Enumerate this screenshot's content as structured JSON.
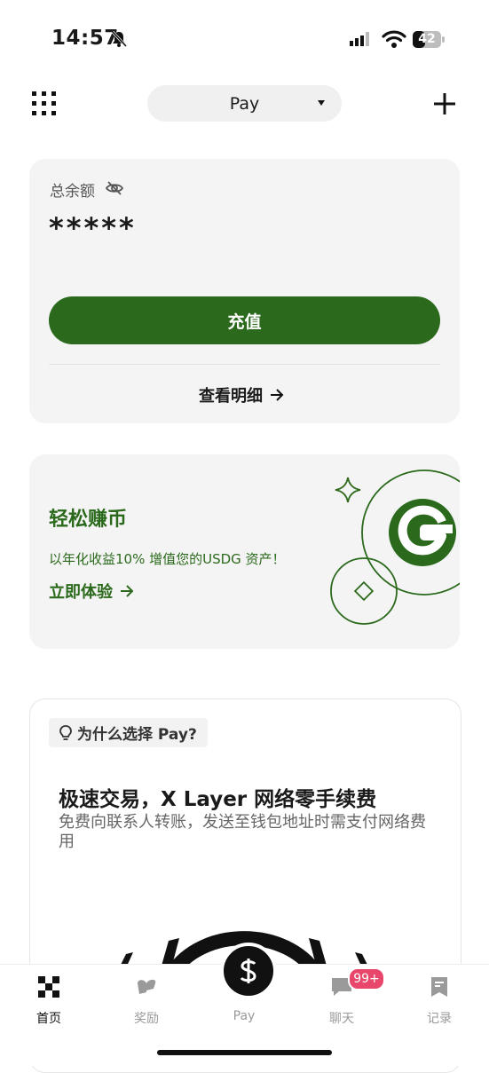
{
  "status_bar": {
    "time": "14:57",
    "battery": "42"
  },
  "top_bar": {
    "selector_label": "Pay"
  },
  "balance": {
    "label": "总余额",
    "value": "*****",
    "deposit_label": "充值",
    "details_label": "查看明细"
  },
  "earn": {
    "title": "轻松赚币",
    "subtitle": "以年化收益10% 增值您的USDG 资产！",
    "cta": "立即体验"
  },
  "why": {
    "chip": "为什么选择 Pay?",
    "title": "极速交易，X Layer 网络零手续费",
    "description": "免费向联系人转账，发送至钱包地址时需支付网络费用"
  },
  "nav": {
    "items": [
      {
        "label": "首页",
        "icon": "okx-logo-icon",
        "active": true
      },
      {
        "label": "奖励",
        "icon": "gift-icon",
        "active": false
      },
      {
        "label": "Pay",
        "icon": "dollar-icon",
        "active": false
      },
      {
        "label": "聊天",
        "icon": "chat-icon",
        "active": false
      },
      {
        "label": "记录",
        "icon": "record-icon",
        "active": false
      }
    ],
    "chat_badge": "99+"
  },
  "colors": {
    "brand_green": "#2b6a1c",
    "badge_red": "#e8466a"
  }
}
